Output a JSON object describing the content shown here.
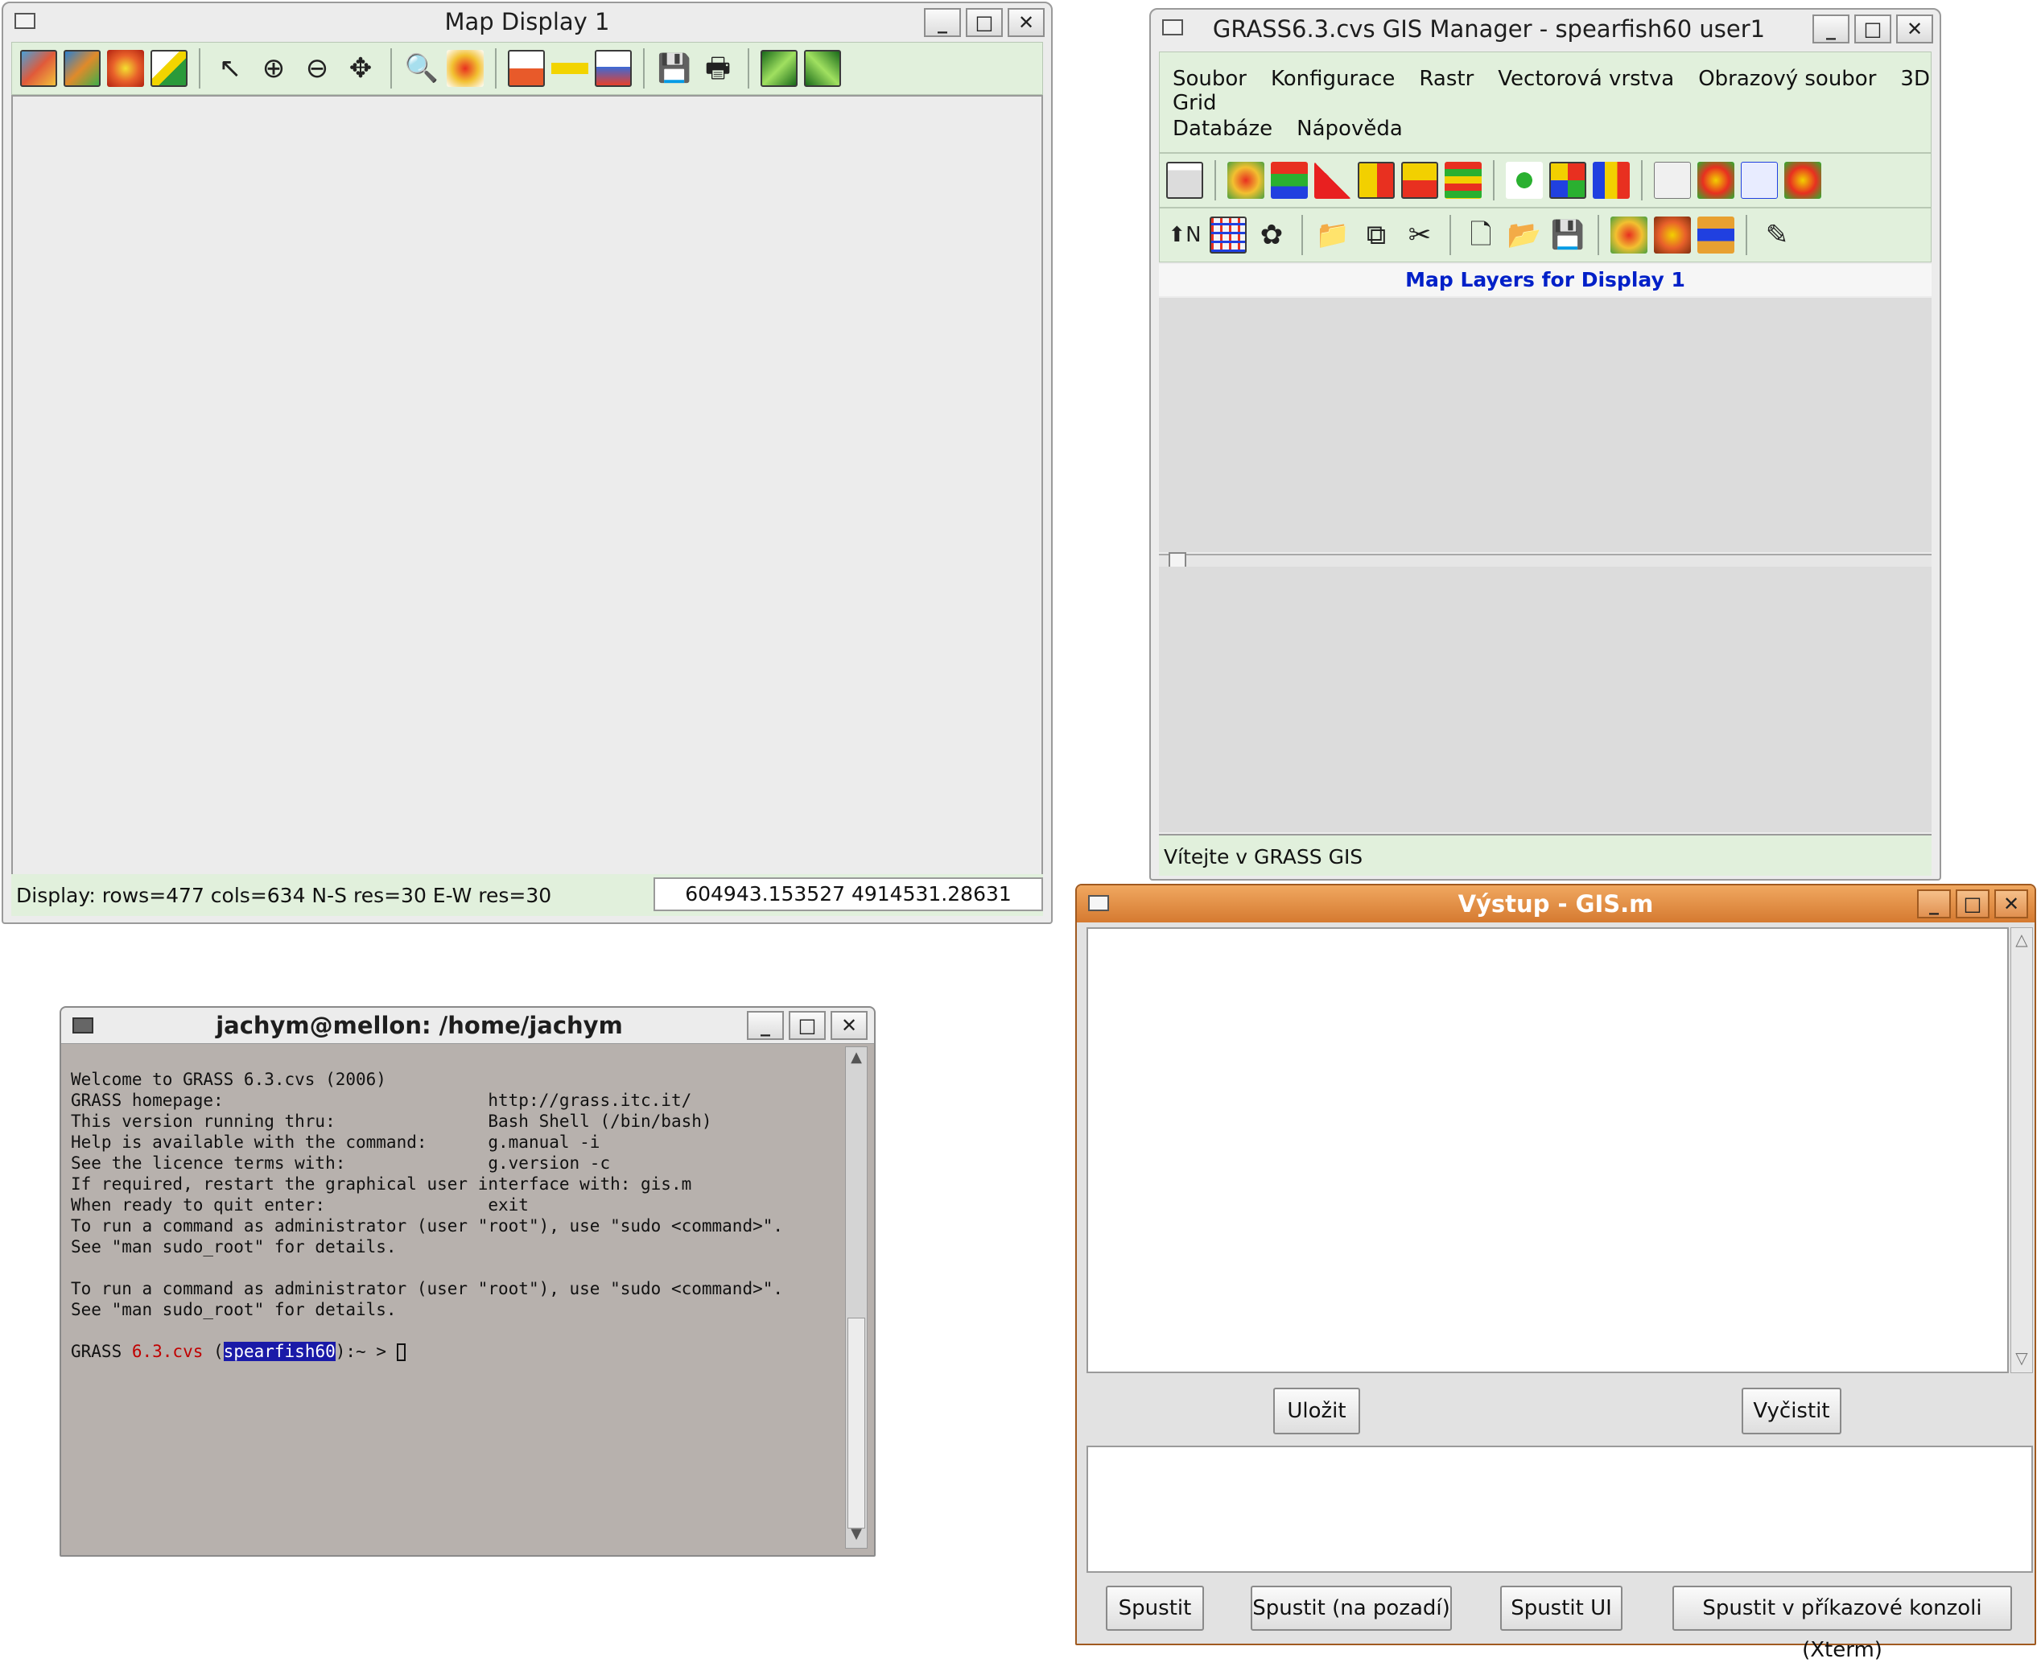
{
  "map_display": {
    "title": "Map Display 1",
    "toolbar": [
      "display-map",
      "display-region",
      "zoom-to-map",
      "erase-icon",
      "pointer-icon",
      "zoom-in-icon",
      "zoom-out-icon",
      "pan-icon",
      "zoom-back-icon",
      "zoom-menu-icon",
      "query-icon",
      "measure-icon",
      "profile-icon",
      "save-icon",
      "print-icon",
      "nviz-icon",
      "nviz2-icon"
    ],
    "status_text": "Display: rows=477 cols=634 N-S res=30 E-W res=30",
    "coords": "604943.153527 4914531.28631"
  },
  "gis_manager": {
    "title": "GRASS6.3.cvs GIS Manager - spearfish60 user1",
    "menu": [
      "Soubor",
      "Konfigurace",
      "Rastr",
      "Vectorová vrstva",
      "Obrazový soubor",
      "3D Grid",
      "Databáze",
      "Nápověda"
    ],
    "layers_header": "Map Layers for Display 1",
    "status": "Vítejte v GRASS GIS"
  },
  "output_window": {
    "title": "Výstup - GIS.m",
    "save_button": "Uložit",
    "clear_button": "Vyčistit",
    "run_button": "Spustit",
    "run_bg_button": "Spustit (na pozadí)",
    "run_ui_button": "Spustit UI",
    "run_xterm_button": "Spustit v příkazové konzoli (Xterm)"
  },
  "terminal": {
    "title": "jachym@mellon: /home/jachym",
    "lines": [
      "Welcome to GRASS 6.3.cvs (2006)",
      "GRASS homepage:                          http://grass.itc.it/",
      "This version running thru:               Bash Shell (/bin/bash)",
      "Help is available with the command:      g.manual -i",
      "See the licence terms with:              g.version -c",
      "If required, restart the graphical user interface with: gis.m",
      "When ready to quit enter:                exit",
      "To run a command as administrator (user \"root\"), use \"sudo <command>\".",
      "See \"man sudo_root\" for details.",
      "",
      "To run a command as administrator (user \"root\"), use \"sudo <command>\".",
      "See \"man sudo_root\" for details."
    ],
    "prompt_prefix": "GRASS ",
    "prompt_version": "6.3.cvs",
    "prompt_open": " (",
    "prompt_location": "spearfish60",
    "prompt_suffix": "):~ > "
  },
  "colors": {
    "panel": "#e1f0dc",
    "term_bg": "#b7b1ad",
    "output_title": "#d9813a",
    "header_blue": "#0020c8",
    "prompt_red": "#c00000",
    "prompt_select_bg": "#1a1aa8"
  }
}
